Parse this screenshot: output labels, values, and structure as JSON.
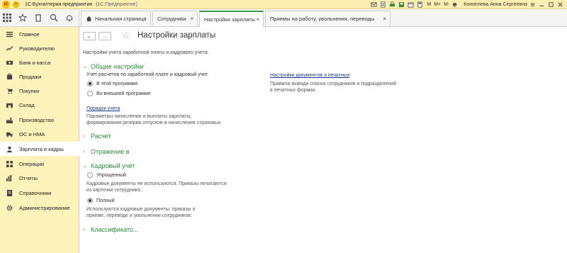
{
  "titlebar": {
    "logo": "1С",
    "app_title": "1С:Бухгалтерия предприятия",
    "app_subtitle": "(1С:Предприятие)",
    "m_label": "M",
    "mplus_label": "M+",
    "mminus_label": "M-",
    "user": "Коноплева Анна Сергеевна"
  },
  "tabs": [
    {
      "label": "Начальная страница"
    },
    {
      "label": "Сотрудники"
    },
    {
      "label": "Настройки зарплаты"
    },
    {
      "label": "Приемы на работу, увольнения, переводы"
    }
  ],
  "tab_close_glyph": "×",
  "sidebar": {
    "items": [
      {
        "label": "Главное",
        "icon": "menu-icon"
      },
      {
        "label": "Руководителю",
        "icon": "chart-icon"
      },
      {
        "label": "Банк и касса",
        "icon": "bank-icon"
      },
      {
        "label": "Продажи",
        "icon": "cart-icon"
      },
      {
        "label": "Покупки",
        "icon": "basket-icon"
      },
      {
        "label": "Склад",
        "icon": "warehouse-icon"
      },
      {
        "label": "Производство",
        "icon": "factory-icon"
      },
      {
        "label": "ОС и НМА",
        "icon": "truck-icon"
      },
      {
        "label": "Зарплата и кадры",
        "icon": "person-icon"
      },
      {
        "label": "Операции",
        "icon": "operations-icon"
      },
      {
        "label": "Отчеты",
        "icon": "reports-icon"
      },
      {
        "label": "Справочники",
        "icon": "book-icon"
      },
      {
        "label": "Администрирование",
        "icon": "gear-icon"
      }
    ]
  },
  "page": {
    "back_glyph": "←",
    "forward_glyph": "→",
    "star_glyph": "☆",
    "title": "Настройки зарплаты",
    "description": "Настройки учета заработной платы и кадрового учета."
  },
  "general": {
    "chevron": "⌄",
    "title": "Общие настройки",
    "accounting_label": "Учет расчетов по заработной плате и кадровый учет",
    "option_internal": "В этой программе",
    "option_external": "Во внешней программе",
    "order_link": "Порядок учета",
    "order_desc_line1": "Параметры начисления и выплаты зарплаты,",
    "order_desc_line2": "формирования резерва отпусков и начисления страховых",
    "docs_link": "Настройки документов и печатных",
    "docs_desc_line1": "Правила вывода списка сотрудников и подразделений",
    "docs_desc_line2": "в печатных формах."
  },
  "collapsed_chevron": "›",
  "calc_section": {
    "title": "Расчет"
  },
  "reflect_section": {
    "title": "Отражение в"
  },
  "hr": {
    "chevron": "⌄",
    "title": "Кадровый учет",
    "option_simple": "Упрощенный",
    "simple_desc_line1": "Кадровые документы не используются. Приказы печатаются",
    "simple_desc_line2": "из карточки сотрудника.",
    "option_full": "Полный",
    "full_desc_line1": "Используются кадровые документы: приказы о",
    "full_desc_line2": "приеме, переводе и увольнении сотрудников."
  },
  "classifier_section": {
    "title": "Классификато..."
  }
}
